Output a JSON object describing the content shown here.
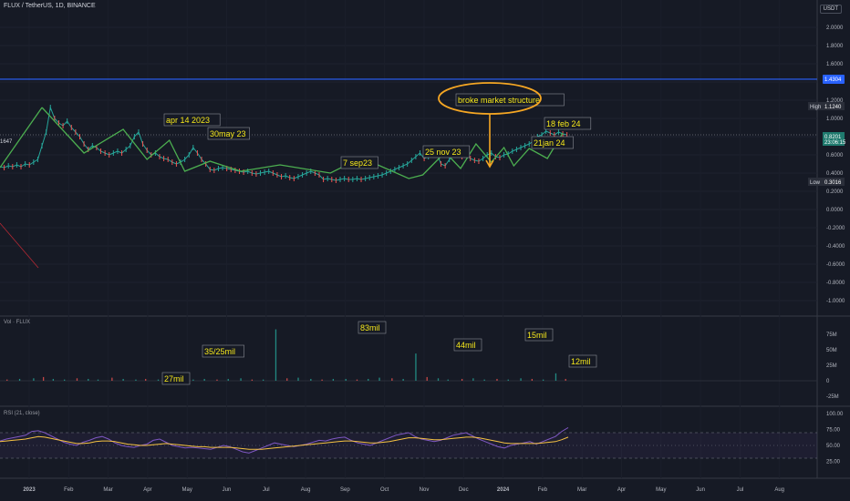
{
  "header": {
    "symbol_line": "FLUX / TetherUS, 1D, BINANCE",
    "currency": "USDT"
  },
  "chart_data": {
    "type": "line",
    "title": "FLUX / TetherUS, 1D, BINANCE",
    "x_axis": {
      "ticks": [
        "2023",
        "Feb",
        "Mar",
        "Apr",
        "May",
        "Jun",
        "Jul",
        "Aug",
        "Sep",
        "Oct",
        "Nov",
        "Dec",
        "2024",
        "Feb",
        "Mar",
        "Apr",
        "May",
        "Jun",
        "Jul",
        "Aug"
      ]
    },
    "price_pane": {
      "ylim": [
        -1.1,
        2.2
      ],
      "ticks": [
        "2.0000",
        "1.8000",
        "1.6000",
        "1.4000",
        "1.2000",
        "1.0000",
        "0.8000",
        "0.6000",
        "0.4000",
        "0.2000",
        "0.0000",
        "-0.2000",
        "-0.4000",
        "-0.6000",
        "-0.8000",
        "-1.0000"
      ],
      "horizontal_line": {
        "value": 1.4304,
        "label": "1.4304",
        "color": "#2962ff"
      },
      "dotted_line": {
        "value": 0.8201
      },
      "markers": [
        {
          "label": "High",
          "value": "1.1240"
        },
        {
          "label": "",
          "value": "0.8201",
          "sub": "23:06:15"
        },
        {
          "label": "Low",
          "value": "0.3016"
        }
      ],
      "left_value": "1647",
      "price_series": {
        "x": [
          0,
          3,
          6,
          9,
          12,
          15,
          18,
          21,
          24,
          27,
          30,
          33,
          36,
          39,
          42,
          45,
          48,
          51,
          54,
          57,
          60,
          63,
          66,
          69,
          72,
          75,
          78,
          81,
          84,
          87,
          90,
          93,
          96,
          99,
          102,
          105,
          108,
          111,
          114,
          117,
          120,
          123,
          126,
          129,
          132,
          135,
          138,
          141,
          144,
          147,
          150,
          153,
          156,
          159,
          162,
          165,
          168,
          171,
          174,
          177,
          180,
          183,
          186,
          189,
          192,
          195,
          198,
          201,
          204,
          207,
          210,
          213,
          216,
          219,
          222,
          225,
          228,
          231,
          234,
          237,
          240,
          243,
          246,
          249,
          252,
          255,
          258,
          261,
          264,
          267,
          270,
          273,
          276,
          279,
          282,
          285,
          288,
          291,
          294,
          297,
          300,
          303,
          306,
          309,
          312,
          315,
          318,
          321,
          324,
          327,
          330,
          333,
          336,
          339,
          342,
          345,
          348,
          351,
          354,
          357,
          360,
          363,
          366,
          369,
          372,
          375,
          378,
          381,
          384,
          387,
          390,
          393,
          396,
          399,
          402,
          405
        ],
        "values": [
          0.47,
          0.46,
          0.48,
          0.47,
          0.49,
          0.47,
          0.5,
          0.49,
          0.52,
          0.55,
          0.7,
          0.85,
          1.12,
          1.0,
          0.95,
          0.92,
          0.97,
          0.9,
          0.85,
          0.8,
          0.72,
          0.66,
          0.7,
          0.68,
          0.64,
          0.62,
          0.6,
          0.62,
          0.64,
          0.62,
          0.66,
          0.7,
          0.8,
          0.85,
          0.72,
          0.65,
          0.6,
          0.62,
          0.58,
          0.56,
          0.55,
          0.52,
          0.5,
          0.52,
          0.55,
          0.6,
          0.68,
          0.62,
          0.55,
          0.5,
          0.44,
          0.43,
          0.45,
          0.46,
          0.45,
          0.44,
          0.43,
          0.42,
          0.41,
          0.42,
          0.4,
          0.39,
          0.4,
          0.41,
          0.42,
          0.4,
          0.38,
          0.36,
          0.37,
          0.35,
          0.34,
          0.36,
          0.38,
          0.4,
          0.42,
          0.4,
          0.38,
          0.33,
          0.34,
          0.33,
          0.32,
          0.33,
          0.34,
          0.33,
          0.33,
          0.34,
          0.33,
          0.34,
          0.35,
          0.36,
          0.37,
          0.38,
          0.4,
          0.42,
          0.44,
          0.46,
          0.48,
          0.5,
          0.54,
          0.58,
          0.62,
          0.56,
          0.58,
          0.6,
          0.62,
          0.5,
          0.48,
          0.55,
          0.6,
          0.62,
          0.58,
          0.6,
          0.56,
          0.54,
          0.53,
          0.56,
          0.6,
          0.62,
          0.58,
          0.57,
          0.6,
          0.61,
          0.64,
          0.66,
          0.68,
          0.7,
          0.72,
          0.75,
          0.8,
          0.82,
          0.86,
          0.84,
          0.82,
          0.85,
          0.83,
          0.82
        ]
      },
      "trend_lines": [
        {
          "x": [
            0,
            30
          ],
          "values": [
            0.46,
            1.12
          ]
        },
        {
          "x": [
            30,
            60,
            88,
            105,
            121,
            132,
            150,
            172,
            200,
            236,
            258,
            292,
            302,
            318,
            329,
            340,
            351,
            360,
            367,
            378,
            391,
            402
          ],
          "values": [
            1.12,
            0.62,
            0.88,
            0.55,
            0.76,
            0.42,
            0.53,
            0.42,
            0.49,
            0.4,
            0.57,
            0.34,
            0.38,
            0.63,
            0.45,
            0.72,
            0.52,
            0.68,
            0.48,
            0.67,
            0.56,
            0.84
          ]
        }
      ],
      "annotations": [
        {
          "text": "apr 14 2023"
        },
        {
          "text": "30may 23"
        },
        {
          "text": "7 sep23"
        },
        {
          "text": "25 nov 23"
        },
        {
          "text": "broke market structure"
        },
        {
          "text": "21jan 24"
        },
        {
          "text": "18 feb 24"
        }
      ]
    },
    "volume_pane": {
      "title": "Vol · FLUX",
      "ticks": [
        "75M",
        "50M",
        "25M",
        "0",
        "-25M"
      ],
      "ylim": [
        -30,
        85
      ],
      "bars_x": [
        5,
        14,
        24,
        31,
        38,
        46,
        55,
        63,
        70,
        80,
        88,
        97,
        104,
        113,
        120,
        130,
        138,
        146,
        155,
        163,
        172,
        180,
        188,
        197,
        205,
        213,
        222,
        230,
        238,
        247,
        255,
        263,
        271,
        280,
        288,
        297,
        305,
        313,
        320,
        330,
        338,
        346,
        355,
        363,
        372,
        380,
        388,
        397,
        404
      ],
      "bars_value": [
        2,
        3,
        4,
        6,
        3,
        2,
        4,
        3,
        2,
        5,
        3,
        2,
        3,
        2,
        7,
        3,
        2,
        3,
        2,
        3,
        4,
        2,
        2,
        83,
        4,
        5,
        3,
        2,
        3,
        3,
        2,
        3,
        5,
        4,
        3,
        44,
        6,
        4,
        2,
        3,
        4,
        2,
        3,
        2,
        4,
        3,
        2,
        12,
        3
      ],
      "annotations": [
        {
          "text": "27mil"
        },
        {
          "text": "35/25mil"
        },
        {
          "text": "83mil"
        },
        {
          "text": "44mil"
        },
        {
          "text": "15mil"
        },
        {
          "text": "12mil"
        }
      ]
    },
    "rsi_pane": {
      "title": "RSI (21, close)",
      "ticks": [
        "100.00",
        "75.00",
        "50.00",
        "25.00"
      ],
      "ylim": [
        0,
        105
      ],
      "bands": [
        70,
        30
      ],
      "rsi_values": [
        57,
        60,
        62,
        64,
        66,
        72,
        73,
        70,
        65,
        60,
        55,
        52,
        50,
        55,
        58,
        62,
        64,
        60,
        54,
        50,
        48,
        47,
        50,
        52,
        58,
        60,
        55,
        50,
        48,
        46,
        47,
        46,
        45,
        44,
        47,
        50,
        48,
        44,
        40,
        38,
        42,
        46,
        50,
        54,
        52,
        50,
        48,
        50,
        52,
        55,
        58,
        57,
        60,
        62,
        63,
        58,
        54,
        52,
        50,
        54,
        58,
        62,
        66,
        68,
        70,
        64,
        60,
        58,
        56,
        58,
        62,
        66,
        68,
        70,
        65,
        60,
        56,
        52,
        48,
        46,
        50,
        52,
        54,
        56,
        52,
        56,
        60,
        64,
        72,
        78
      ],
      "ma_values": [
        56,
        57,
        58,
        59,
        60,
        62,
        64,
        63,
        61,
        59,
        57,
        55,
        53,
        53,
        54,
        56,
        57,
        57,
        56,
        54,
        52,
        51,
        50,
        50,
        51,
        52,
        53,
        52,
        51,
        50,
        49,
        48,
        48,
        47,
        47,
        47,
        47,
        46,
        45,
        44,
        44,
        44,
        45,
        46,
        47,
        48,
        49,
        50,
        51,
        52,
        53,
        54,
        55,
        56,
        57,
        57,
        56,
        55,
        54,
        54,
        55,
        56,
        58,
        60,
        62,
        62,
        61,
        60,
        59,
        59,
        60,
        61,
        62,
        63,
        63,
        62,
        60,
        58,
        56,
        54,
        53,
        53,
        53,
        53,
        53,
        54,
        55,
        56,
        59,
        63
      ]
    }
  }
}
